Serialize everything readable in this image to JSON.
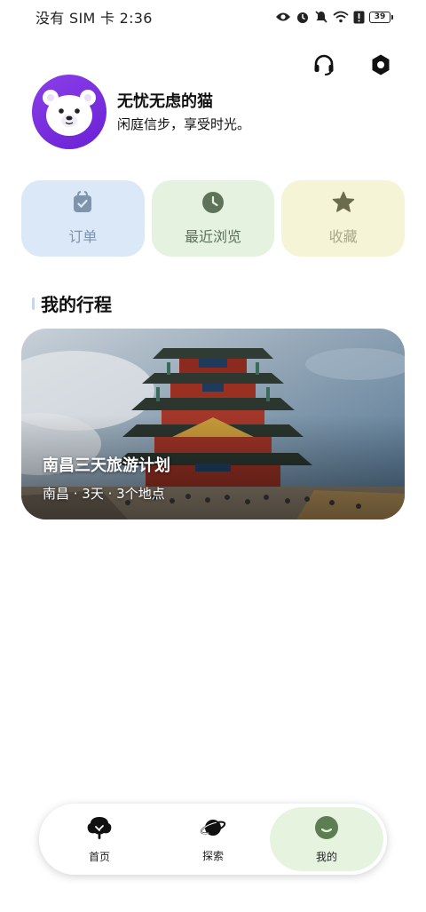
{
  "status_bar": {
    "left_text": "没有 SIM 卡 2:36",
    "battery_level": "39",
    "icons": [
      "eye-icon",
      "alarm-icon",
      "mute-icon",
      "wifi-icon",
      "alert-icon",
      "battery-icon"
    ]
  },
  "header": {
    "icons": [
      "headset-icon",
      "settings-icon"
    ]
  },
  "profile": {
    "name": "无忧无虑的猫",
    "bio": "闲庭信步，享受时光。",
    "avatar_icon": "polar-bear-avatar",
    "avatar_color": "#7b2fe0"
  },
  "quick_actions": [
    {
      "label": "订单",
      "icon": "shopping-bag-icon",
      "bg": "#dbe8f8"
    },
    {
      "label": "最近浏览",
      "icon": "clock-icon",
      "bg": "#e4f2df"
    },
    {
      "label": "收藏",
      "icon": "star-icon",
      "bg": "#f6f4d6"
    }
  ],
  "section": {
    "title": "我的行程"
  },
  "trip": {
    "title": "南昌三天旅游计划",
    "meta": "南昌 · 3天 · 3个地点"
  },
  "bottom_nav": {
    "items": [
      {
        "label": "首页",
        "icon": "tree-icon"
      },
      {
        "label": "探索",
        "icon": "planet-icon"
      },
      {
        "label": "我的",
        "icon": "smile-icon"
      }
    ],
    "active_index": 2,
    "active_color": "#e6f4df"
  }
}
